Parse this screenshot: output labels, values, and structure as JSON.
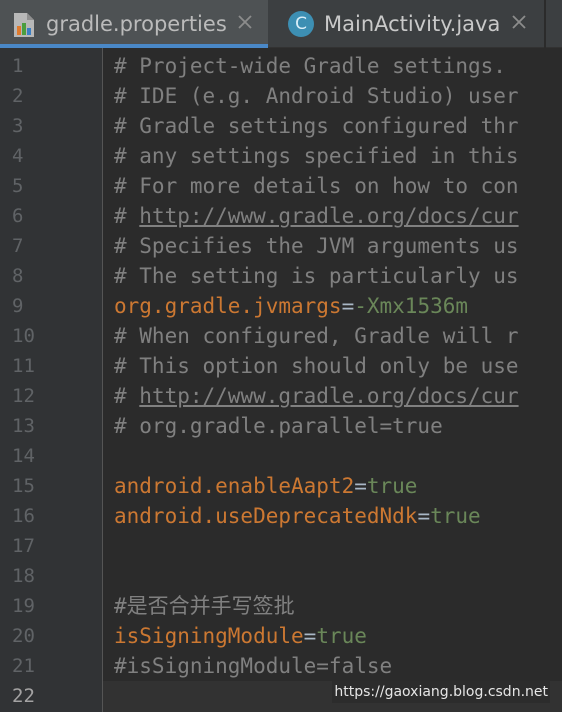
{
  "tabs": [
    {
      "label": "gradle.properties",
      "icon": "properties-file-icon",
      "active": true
    },
    {
      "label": "MainActivity.java",
      "icon": "java-class-icon",
      "icon_letter": "C",
      "active": false
    }
  ],
  "editor": {
    "current_line": 22,
    "line_numbers": [
      "1",
      "2",
      "3",
      "4",
      "5",
      "6",
      "7",
      "8",
      "9",
      "10",
      "11",
      "12",
      "13",
      "14",
      "15",
      "16",
      "17",
      "18",
      "19",
      "20",
      "21",
      "22"
    ],
    "lines": [
      {
        "n": 1,
        "kind": "comment",
        "text": "# Project-wide Gradle settings."
      },
      {
        "n": 2,
        "kind": "comment",
        "text": "# IDE (e.g. Android Studio) user"
      },
      {
        "n": 3,
        "kind": "comment",
        "text": "# Gradle settings configured thr"
      },
      {
        "n": 4,
        "kind": "comment",
        "text": "# any settings specified in this"
      },
      {
        "n": 5,
        "kind": "comment",
        "text": "# For more details on how to con"
      },
      {
        "n": 6,
        "kind": "link-comment",
        "prefix": "# ",
        "link": "http://www.gradle.org/docs/cur"
      },
      {
        "n": 7,
        "kind": "comment",
        "text": "# Specifies the JVM arguments us"
      },
      {
        "n": 8,
        "kind": "comment",
        "text": "# The setting is particularly us"
      },
      {
        "n": 9,
        "kind": "property",
        "key": "org.gradle.jvmargs",
        "eq": "=",
        "value": "-Xmx1536m"
      },
      {
        "n": 10,
        "kind": "comment",
        "text": "# When configured, Gradle will r"
      },
      {
        "n": 11,
        "kind": "comment",
        "text": "# This option should only be use"
      },
      {
        "n": 12,
        "kind": "link-comment",
        "prefix": "# ",
        "link": "http://www.gradle.org/docs/cur"
      },
      {
        "n": 13,
        "kind": "comment",
        "text": "# org.gradle.parallel=true"
      },
      {
        "n": 14,
        "kind": "blank",
        "text": ""
      },
      {
        "n": 15,
        "kind": "property",
        "key": "android.enableAapt2",
        "eq": "=",
        "value": "true"
      },
      {
        "n": 16,
        "kind": "property",
        "key": "android.useDeprecatedNdk",
        "eq": "=",
        "value": "true"
      },
      {
        "n": 17,
        "kind": "blank",
        "text": ""
      },
      {
        "n": 18,
        "kind": "blank",
        "text": ""
      },
      {
        "n": 19,
        "kind": "comment",
        "text": "#是否合并手写签批"
      },
      {
        "n": 20,
        "kind": "property",
        "key": "isSigningModule",
        "eq": "=",
        "value": "true"
      },
      {
        "n": 21,
        "kind": "comment",
        "text": "#isSigningModule=false"
      },
      {
        "n": 22,
        "kind": "blank",
        "text": ""
      }
    ]
  },
  "watermark": "https://gaoxiang.blog.csdn.net",
  "colors": {
    "background": "#2b2b2b",
    "comment": "#808080",
    "key": "#cc7832",
    "value": "#6a8759",
    "tab_underline": "#4a88c7"
  }
}
